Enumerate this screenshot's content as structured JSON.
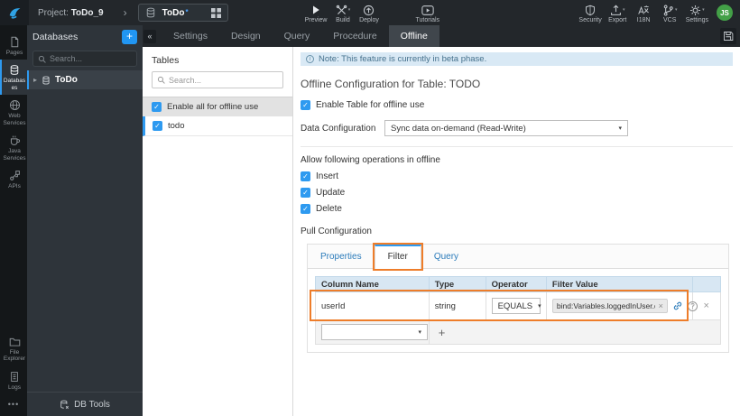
{
  "colors": {
    "accent_blue": "#2e9af0",
    "annotation_orange": "#ee7d2a",
    "link_blue": "#2b7bba",
    "avatar_green": "#43a047",
    "note_bg": "#d9e9f5"
  },
  "icons": {
    "add": "+",
    "collapse": "«",
    "chevron": "›",
    "caret_down": "▾",
    "tree_caret": "▸",
    "check": "✓",
    "close": "×",
    "plus": "+",
    "more": "•••",
    "info": "i",
    "help": "?"
  },
  "header": {
    "project_label": "Project:",
    "project_name": "ToDo_9",
    "doc_tab": {
      "title": "ToDo",
      "dirty_marker": "*"
    },
    "actions_left": [
      {
        "label": "Preview"
      },
      {
        "label": "Build"
      },
      {
        "label": "Deploy"
      },
      {
        "label": "Tutorials"
      }
    ],
    "actions_right": [
      {
        "label": "Security"
      },
      {
        "label": "Export"
      },
      {
        "label": "I18N"
      },
      {
        "label": "VCS"
      },
      {
        "label": "Settings"
      }
    ],
    "avatar_initials": "JS"
  },
  "icon_rail": {
    "top_items": [
      {
        "label": "Pages"
      },
      {
        "label": "Databases",
        "active": true
      },
      {
        "label": "Web Services"
      },
      {
        "label": "Java Services"
      },
      {
        "label": "APIs"
      }
    ],
    "bottom_items": [
      {
        "label": "File Explorer"
      },
      {
        "label": "Logs"
      }
    ]
  },
  "db_panel": {
    "title": "Databases",
    "search_placeholder": "Search...",
    "tree_items": [
      {
        "label": "ToDo"
      }
    ],
    "footer_label": "DB Tools"
  },
  "service_tabs": [
    "Settings",
    "Design",
    "Query",
    "Procedure",
    "Offline"
  ],
  "tables_panel": {
    "title": "Tables",
    "search_placeholder": "Search...",
    "enable_all": {
      "label": "Enable all for offline use",
      "checked": true
    },
    "tables": [
      {
        "label": "todo",
        "checked": true,
        "selected": true
      }
    ]
  },
  "offline_config": {
    "note": "Note: This feature is currently in beta phase.",
    "title": "Offline Configuration for Table: TODO",
    "enable_table": {
      "label": "Enable Table for offline use",
      "checked": true
    },
    "data_configuration": {
      "label": "Data Configuration",
      "value": "Sync data on-demand (Read-Write)"
    },
    "operations": {
      "label": "Allow following operations in offline",
      "items": [
        {
          "label": "Insert",
          "checked": true
        },
        {
          "label": "Update",
          "checked": true
        },
        {
          "label": "Delete",
          "checked": true
        }
      ]
    },
    "pull_configuration": {
      "label": "Pull Configuration",
      "tabs": [
        "Properties",
        "Filter",
        "Query"
      ],
      "active_tab": "Filter",
      "filter_table": {
        "headers": [
          "Column Name",
          "Type",
          "Operator",
          "Filter Value",
          ""
        ],
        "rows": [
          {
            "column_name": "userId",
            "type": "string",
            "operator": "EQUALS",
            "filter_value": "bind:Variables.loggedInUser.data"
          }
        ]
      }
    }
  }
}
